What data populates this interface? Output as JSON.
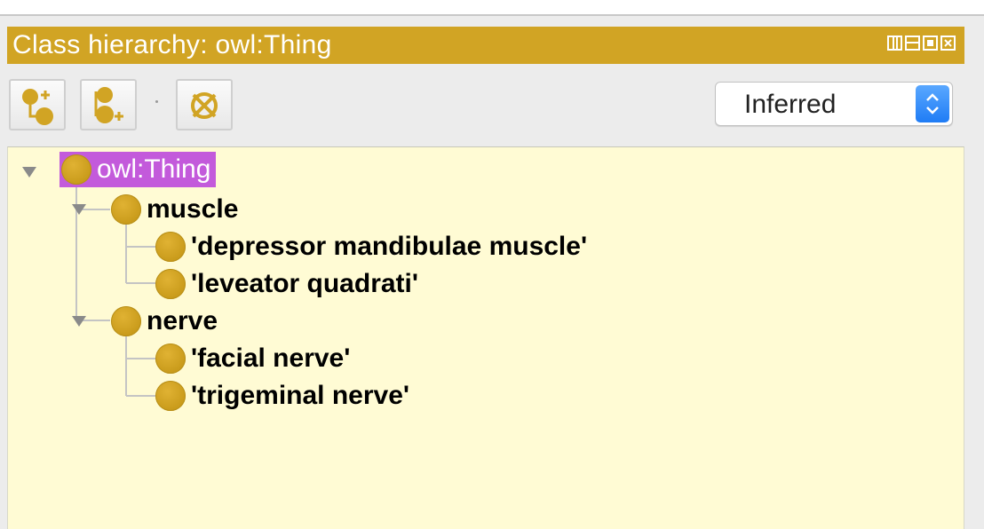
{
  "panel": {
    "title": "Class hierarchy: owl:Thing",
    "accent_color": "#d1a424",
    "view_controls": [
      "columns-icon",
      "rows-icon",
      "maximize-icon",
      "close-icon"
    ]
  },
  "toolbar": {
    "buttons": [
      {
        "name": "add-subclass-button",
        "icon": "add-subclass-icon"
      },
      {
        "name": "add-sibling-button",
        "icon": "add-sibling-icon"
      },
      {
        "name": "delete-class-button",
        "icon": "delete-class-icon"
      }
    ],
    "hierarchy_mode": {
      "selected": "Inferred"
    }
  },
  "tree": {
    "background": "#fffbd4",
    "selection_color": "#c35adb",
    "root": {
      "label": "owl:Thing",
      "expanded": true,
      "selected": true
    },
    "children": [
      {
        "label": "muscle",
        "expanded": true,
        "children": [
          {
            "label": "'depressor mandibulae muscle'"
          },
          {
            "label": "'leveator quadrati'"
          }
        ]
      },
      {
        "label": "nerve",
        "expanded": true,
        "children": [
          {
            "label": "'facial nerve'"
          },
          {
            "label": "'trigeminal nerve'"
          }
        ]
      }
    ]
  }
}
